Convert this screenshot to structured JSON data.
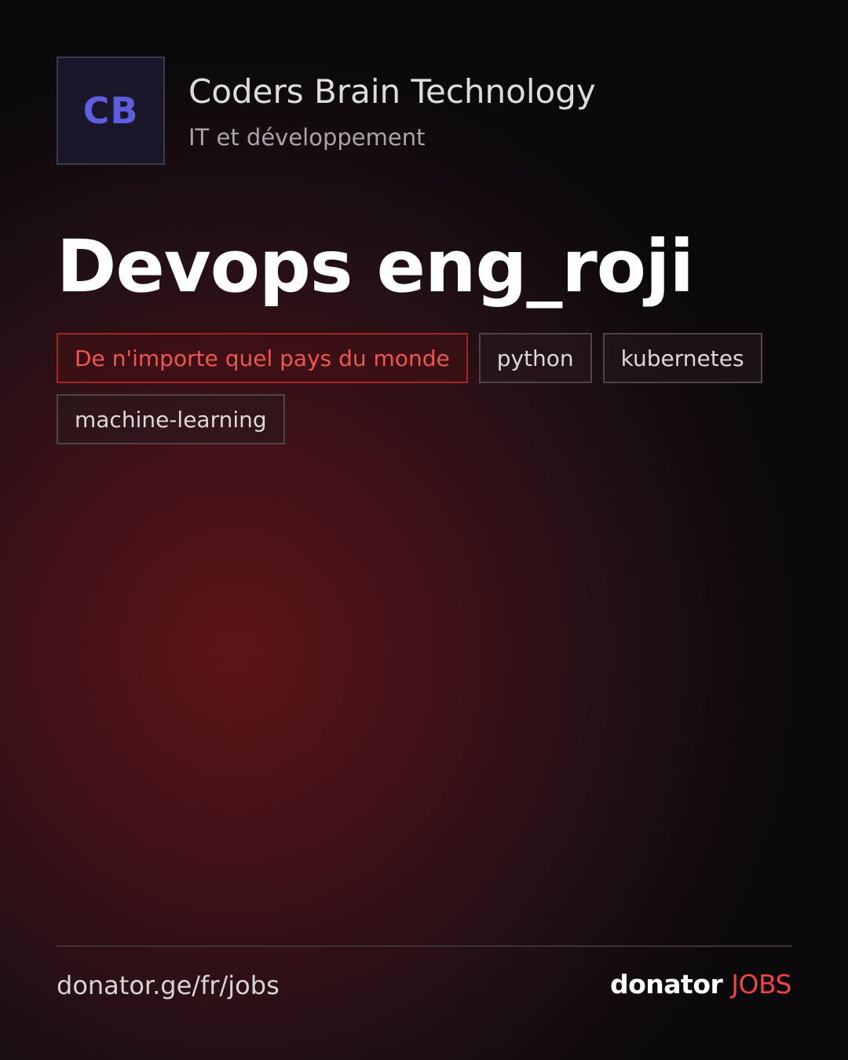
{
  "company": {
    "logo_initials": "CB",
    "name": "Coders Brain Technology",
    "sector": "IT et développement"
  },
  "job": {
    "title": "Devops eng_roji"
  },
  "tags": [
    {
      "label": "De n'importe quel pays du monde",
      "kind": "location"
    },
    {
      "label": "python",
      "kind": "skill"
    },
    {
      "label": "kubernetes",
      "kind": "skill"
    },
    {
      "label": "machine-learning",
      "kind": "skill"
    }
  ],
  "footer": {
    "url": "donator.ge/fr/jobs",
    "brand_main": "donator",
    "brand_accent": "JOBS"
  },
  "colors": {
    "accent": "#ef4444",
    "logo_text": "#5e5ee0",
    "logo_bg": "#1a172b",
    "background_glow": "#5e1517"
  }
}
